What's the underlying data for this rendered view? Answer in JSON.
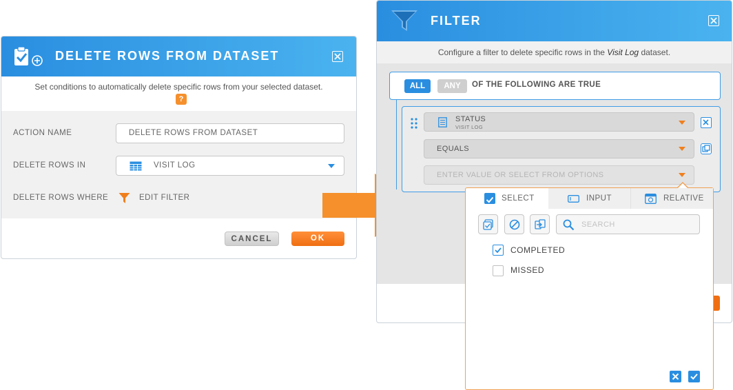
{
  "delete_dialog": {
    "title": "DELETE ROWS FROM DATASET",
    "description": "Set conditions to automatically delete specific rows from your selected dataset.",
    "help_label": "?",
    "fields": {
      "action_name_label": "ACTION NAME",
      "action_name_value": "DELETE ROWS FROM DATASET",
      "delete_rows_in_label": "DELETE ROWS IN",
      "delete_rows_in_value": "VISIT LOG",
      "delete_rows_where_label": "DELETE ROWS WHERE",
      "edit_filter_label": "EDIT FILTER"
    },
    "cancel_label": "CANCEL",
    "ok_label": "OK"
  },
  "filter_dialog": {
    "title": "FILTER",
    "description_prefix": "Configure a filter to delete specific rows in the",
    "dataset_name": "Visit Log",
    "description_suffix": "dataset.",
    "toggle_all": "ALL",
    "toggle_any": "ANY",
    "condition_text": "OF THE FOLLOWING ARE TRUE",
    "rule": {
      "field_name": "STATUS",
      "field_dataset": "VISIT LOG",
      "operator": "EQUALS",
      "value_placeholder": "ENTER VALUE OR SELECT FROM OPTIONS"
    }
  },
  "value_popover": {
    "tabs": [
      "SELECT",
      "INPUT",
      "RELATIVE"
    ],
    "search_placeholder": "SEARCH",
    "options": [
      {
        "label": "COMPLETED",
        "checked": true
      },
      {
        "label": "MISSED",
        "checked": false
      }
    ]
  },
  "colors": {
    "header_blue": "#2a8ee0",
    "accent_orange": "#f07f1c",
    "popover_border": "#f0a050"
  }
}
